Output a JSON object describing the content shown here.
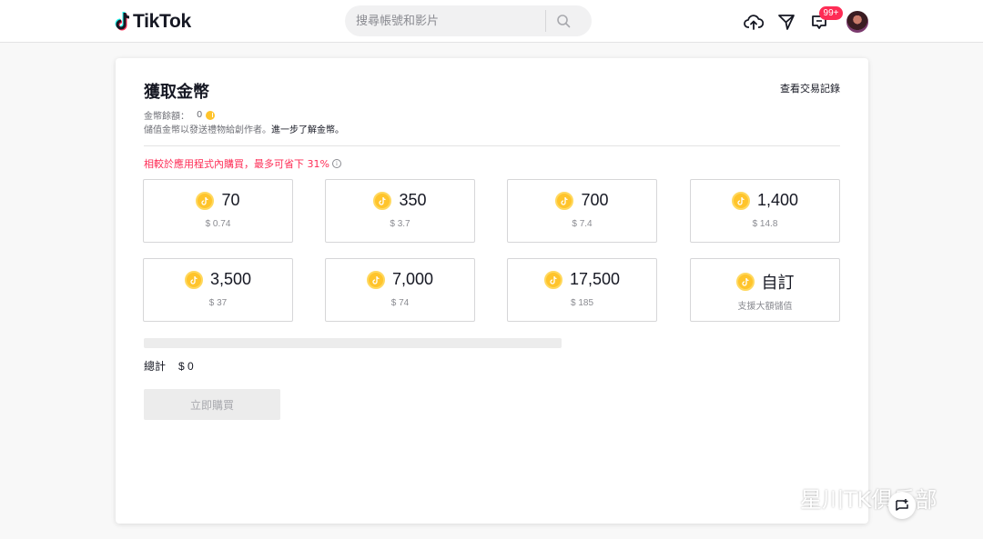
{
  "header": {
    "logo_text": "TikTok",
    "search_placeholder": "搜尋帳號和影片",
    "inbox_badge": "99+"
  },
  "page": {
    "title": "獲取金幣",
    "history_link": "查看交易記錄",
    "balance_label": "金幣餘額：",
    "balance_value": "0",
    "description": "儲值金幣以發送禮物給創作者。",
    "learn_more": "進一步了解金幣。",
    "promo": "相較於應用程式內購買，最多可省下 31%"
  },
  "packages": [
    {
      "amount": "70",
      "price": "$ 0.74"
    },
    {
      "amount": "350",
      "price": "$ 3.7"
    },
    {
      "amount": "700",
      "price": "$ 7.4"
    },
    {
      "amount": "1,400",
      "price": "$ 14.8"
    },
    {
      "amount": "3,500",
      "price": "$ 37"
    },
    {
      "amount": "7,000",
      "price": "$ 74"
    },
    {
      "amount": "17,500",
      "price": "$ 185"
    },
    {
      "amount": "自訂",
      "price": "支援大額儲值"
    }
  ],
  "checkout": {
    "total_label": "總計",
    "total_value": "$ 0",
    "buy_label": "立即購買"
  },
  "watermark": {
    "text": "星川TK俱乐部"
  },
  "colors": {
    "accent": "#fe2c55",
    "coin": "#ffc42b"
  }
}
